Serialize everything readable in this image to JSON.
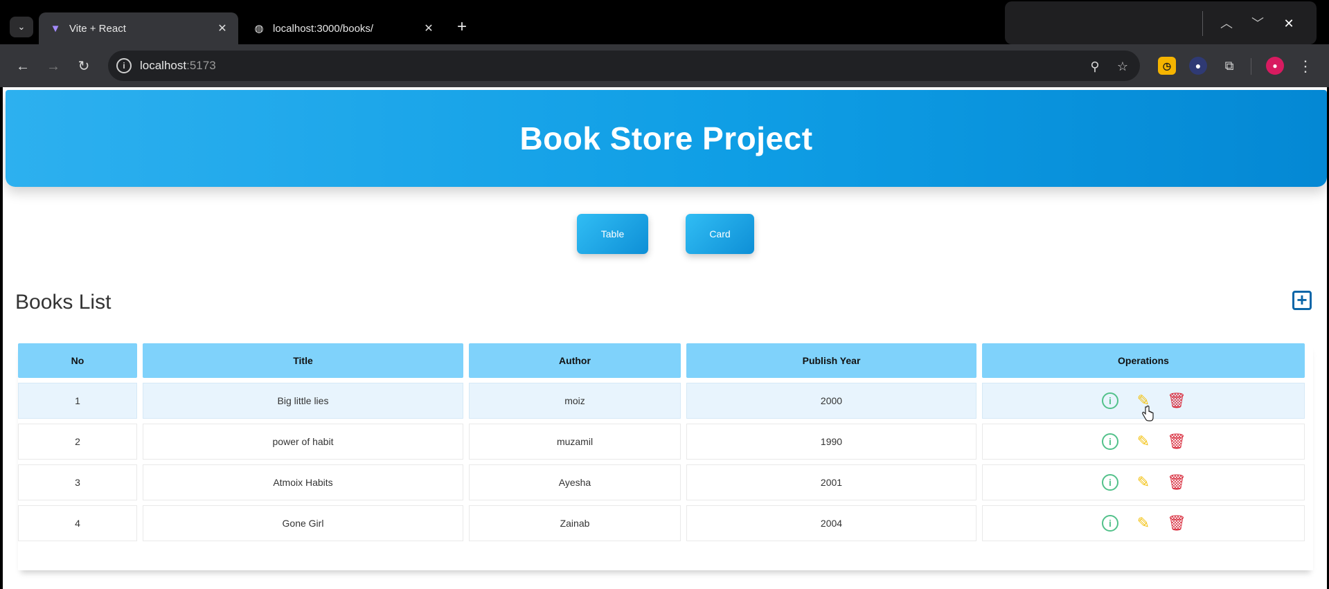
{
  "browser": {
    "tabs": [
      {
        "title": "Vite + React",
        "favicon": "vite-icon"
      },
      {
        "title": "localhost:3000/books/",
        "favicon": "globe-icon"
      }
    ],
    "url_host": "localhost",
    "url_port": ":5173"
  },
  "header": {
    "title": "Book Store Project"
  },
  "view_toggle": {
    "table_label": "Table",
    "card_label": "Card"
  },
  "books": {
    "title": "Books List",
    "columns": [
      "No",
      "Title",
      "Author",
      "Publish Year",
      "Operations"
    ],
    "rows": [
      {
        "no": "1",
        "title": "Big little lies",
        "author": "moiz",
        "year": "2000"
      },
      {
        "no": "2",
        "title": "power of habit",
        "author": "muzamil",
        "year": "1990"
      },
      {
        "no": "3",
        "title": "Atmoix Habits",
        "author": "Ayesha",
        "year": "2001"
      },
      {
        "no": "4",
        "title": "Gone Girl",
        "author": "Zainab",
        "year": "2004"
      }
    ]
  },
  "colors": {
    "header_gradient": [
      "#2db0ef",
      "#0488d4"
    ],
    "table_header": "#7fd2fb",
    "info_icon": "#52c18a",
    "edit_icon": "#f3c212",
    "delete_icon": "#d82b3c"
  }
}
